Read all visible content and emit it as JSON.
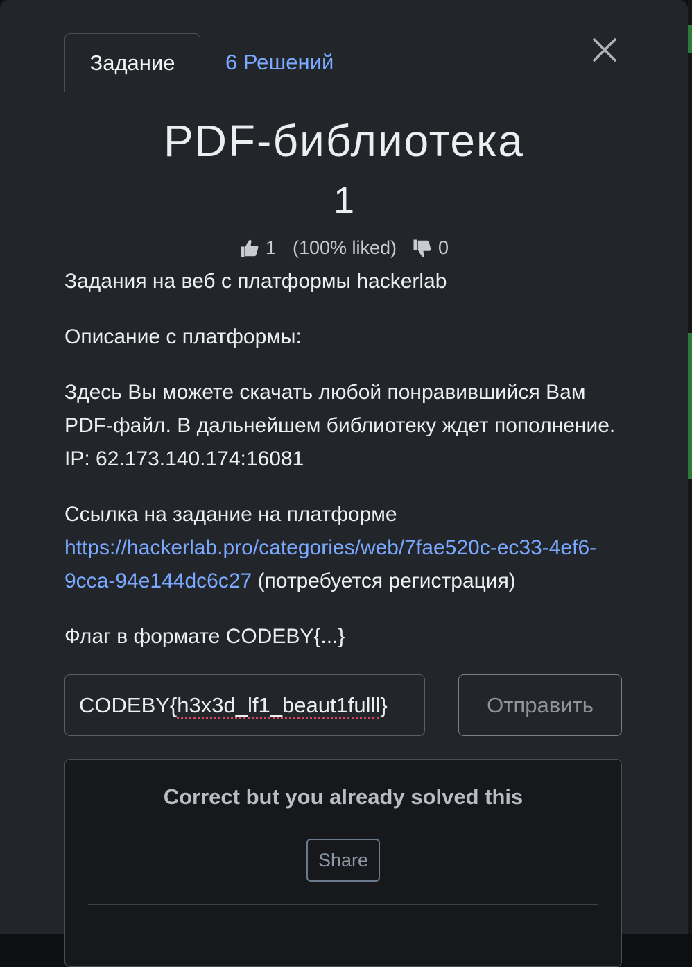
{
  "tabs": {
    "challenge_label": "Задание",
    "solves_label": "6 Решений"
  },
  "challenge": {
    "title": "PDF-библиотека",
    "value": "1",
    "likes": "1",
    "liked_percent": "(100% liked)",
    "dislikes": "0"
  },
  "description": {
    "line1": "Задания на веб с платформы hackerlab",
    "line2": "Описание с платформы:",
    "line3": "Здесь Вы можете скачать любой понравившийся Вам PDF-файл. В дальнейшем библиотеку ждет пополнение. IP: 62.173.140.174:16081",
    "line4_text": "Ссылка на задание на платформе",
    "link": "https://hackerlab.pro/categories/web/7fae520c-ec33-4ef6-9cca-94e144dc6c27",
    "link_note": " (потребуется регистрация)",
    "line5": "Флаг в формате CODEBY{...}"
  },
  "flag_form": {
    "input_value_prefix": "CODEBY{",
    "input_value_body": "h3x3d_lf1_beaut1fulll",
    "input_value_suffix": "}",
    "submit_label": "Отправить"
  },
  "result": {
    "message": "Correct but you already solved this",
    "share_label": "Share"
  },
  "icons": {
    "close": "close-icon",
    "like": "thumbs-up-icon",
    "dislike": "thumbs-down-icon"
  },
  "colors": {
    "link": "#7aa9ff",
    "modal_bg": "#22252a"
  }
}
